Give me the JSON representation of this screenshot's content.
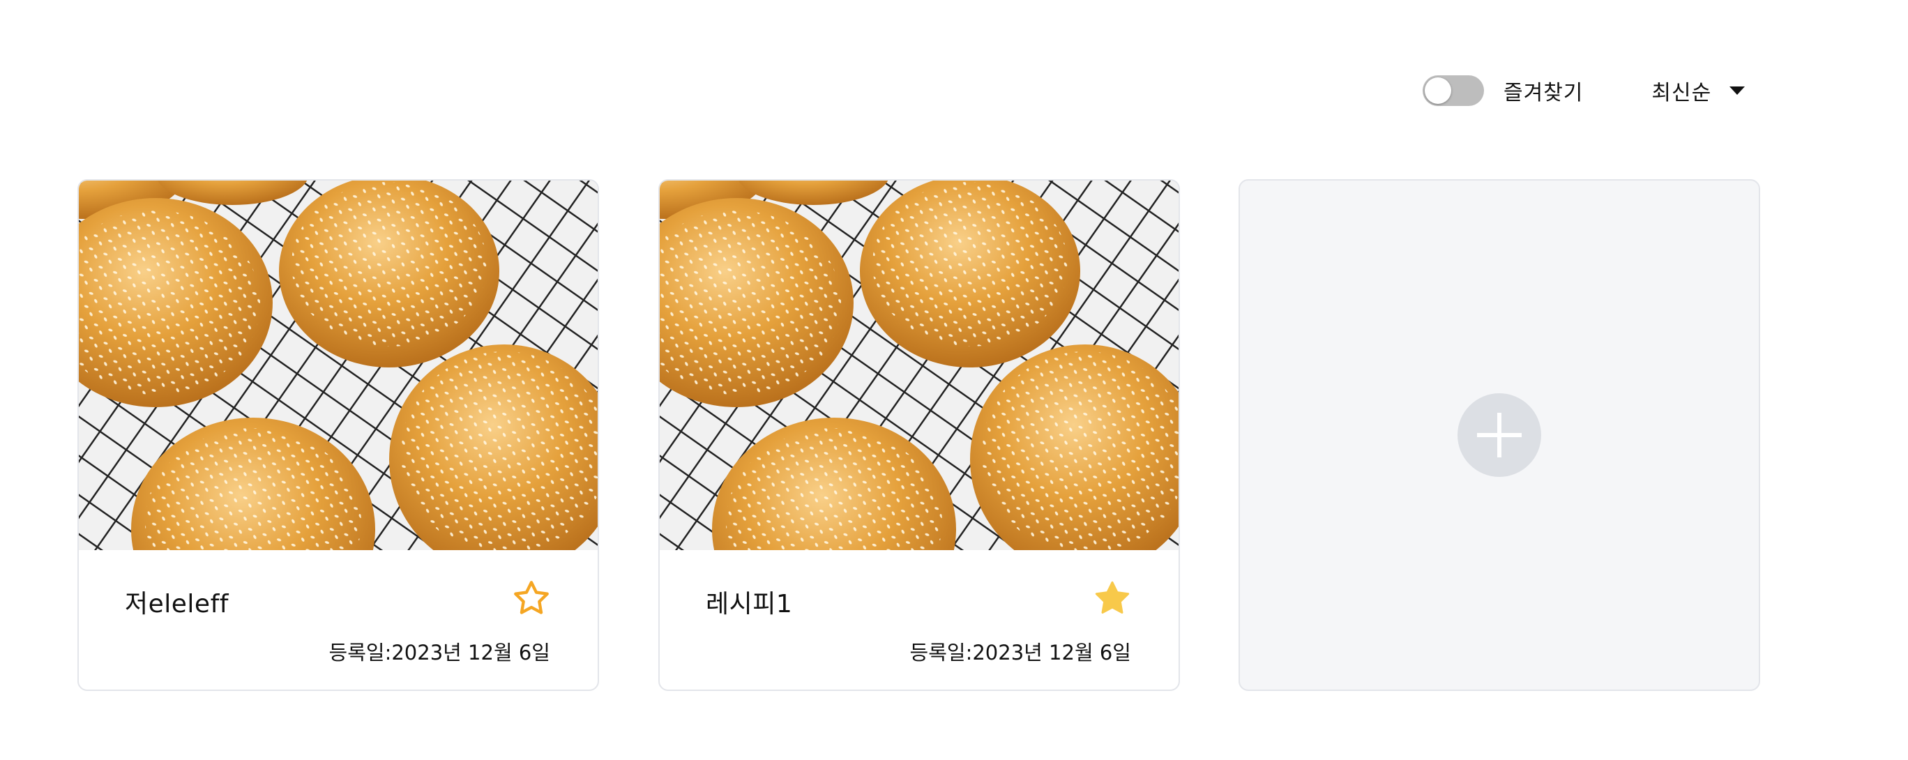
{
  "toolbar": {
    "favorites_toggle_label": "즐겨찾기",
    "favorites_toggle_on": false,
    "sort_label": "최신순"
  },
  "cards": [
    {
      "title": "저eleleff",
      "date": "등록일:2023년 12월 6일",
      "favorite": false,
      "image_icon": "sesame-bun-photo"
    },
    {
      "title": "레시피1",
      "date": "등록일:2023년 12월 6일",
      "favorite": true,
      "image_icon": "sesame-bun-photo"
    }
  ],
  "add_card": {
    "icon": "plus-icon"
  },
  "colors": {
    "star_outline": "#f5a623",
    "star_filled": "#f8c94a",
    "toggle_off": "#bdbdbd",
    "add_card_bg": "#f5f6f8"
  }
}
